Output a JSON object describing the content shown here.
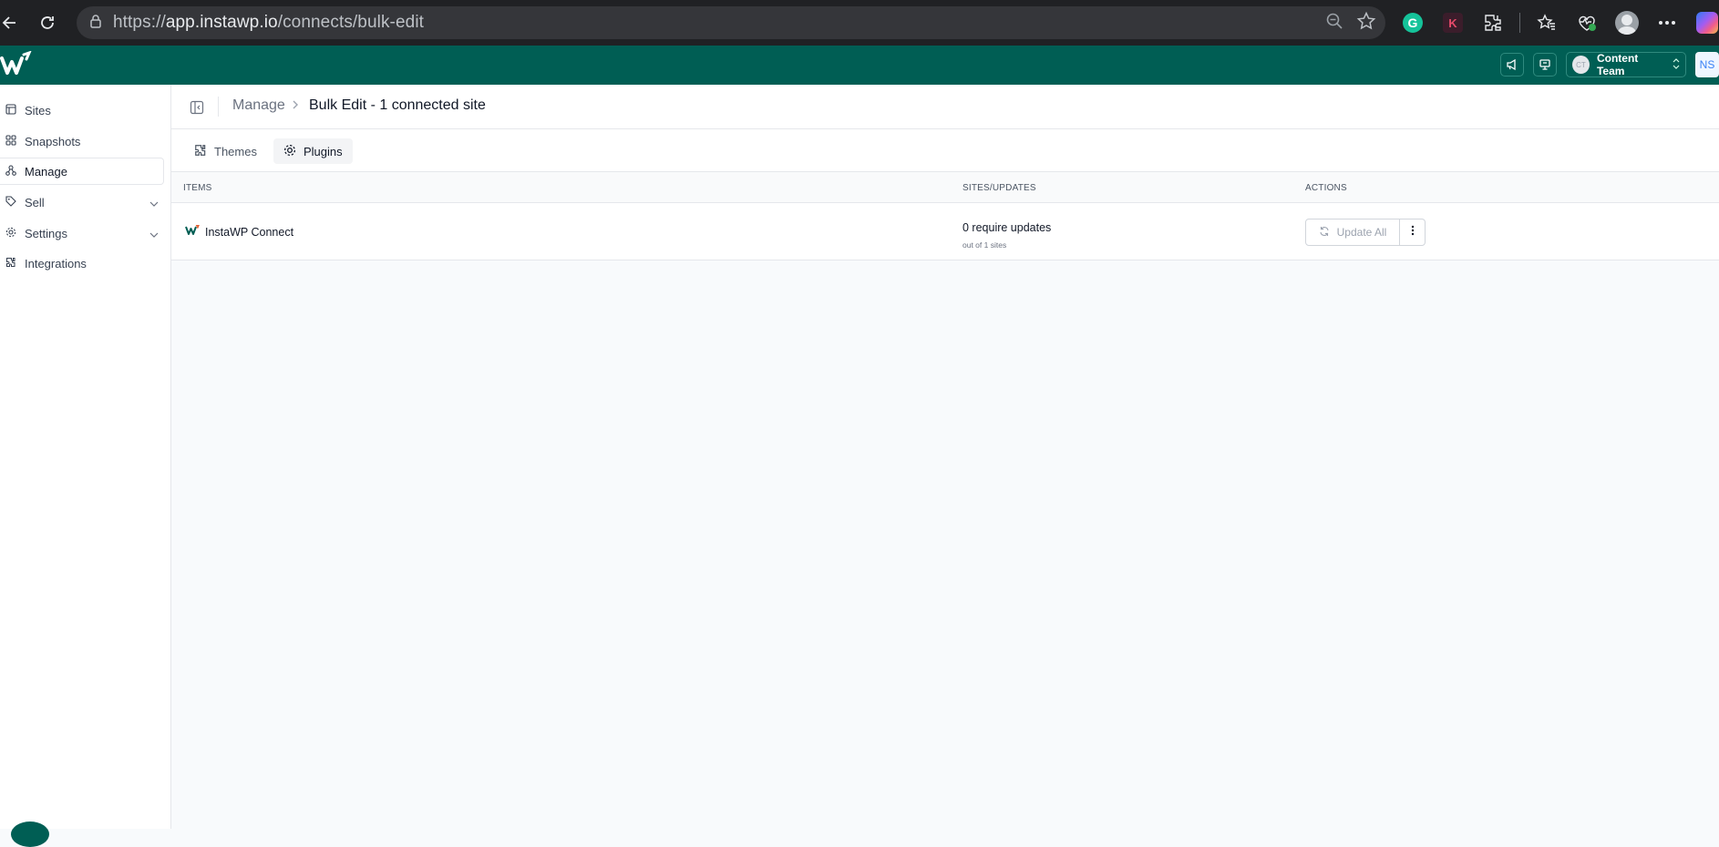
{
  "browser": {
    "url_prefix": "https://",
    "url_host": "app.instawp.io",
    "url_path": "/connects/bulk-edit",
    "extensions": [
      "grammarly-icon",
      "k-extension-icon",
      "extensions-icon",
      "favorites-icon",
      "health-icon",
      "profile-icon",
      "more-icon",
      "copilot-icon"
    ],
    "grammarly_letter": "G",
    "k_letter": "K"
  },
  "header": {
    "team_name": "Content Team",
    "team_initials": "CT",
    "user_initials": "NS"
  },
  "sidebar": {
    "items": [
      {
        "label": "Sites",
        "icon": "sites-icon",
        "has_chevron": false,
        "active": false
      },
      {
        "label": "Snapshots",
        "icon": "snapshots-icon",
        "has_chevron": false,
        "active": false
      },
      {
        "label": "Manage",
        "icon": "manage-icon",
        "has_chevron": false,
        "active": true
      },
      {
        "label": "Sell",
        "icon": "tag-icon",
        "has_chevron": true,
        "active": false
      },
      {
        "label": "Settings",
        "icon": "gear-icon",
        "has_chevron": true,
        "active": false
      },
      {
        "label": "Integrations",
        "icon": "puzzle-icon",
        "has_chevron": false,
        "active": false
      }
    ]
  },
  "breadcrumb": {
    "parent": "Manage",
    "current": "Bulk Edit - 1 connected site"
  },
  "tabs": [
    {
      "label": "Themes",
      "icon": "puzzle-icon",
      "active": false
    },
    {
      "label": "Plugins",
      "icon": "gear-icon",
      "active": true
    }
  ],
  "table": {
    "columns": [
      "ITEMS",
      "SITES/UPDATES",
      "ACTIONS"
    ],
    "rows": [
      {
        "item": "InstaWP Connect",
        "updates": "0 require updates",
        "sites": "out of 1 sites",
        "action": "Update All"
      }
    ]
  },
  "colors": {
    "brand": "#005e54",
    "browser_bg": "#202124"
  }
}
